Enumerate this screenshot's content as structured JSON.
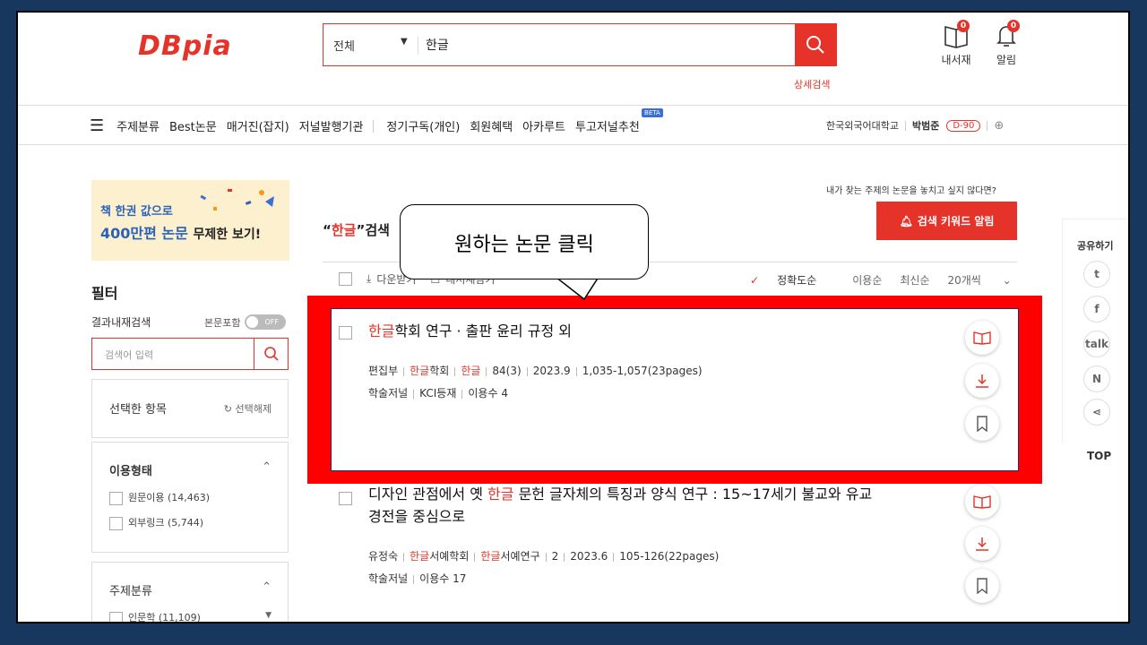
{
  "header": {
    "logo": "DBpia",
    "search_scope": "전체",
    "search_query": "한글",
    "advanced_search": "상세검색",
    "library_label": "내서재",
    "library_count": "0",
    "alarm_label": "알림",
    "alarm_count": "0"
  },
  "nav": {
    "items": [
      "주제분류",
      "Best논문",
      "매거진(잡지)",
      "저널발행기관",
      "정기구독(개인)",
      "회원혜택",
      "아카루트",
      "투고저널추천"
    ],
    "beta": "BETA",
    "university": "한국외국어대학교",
    "user_name": "박범준",
    "dday": "D-90"
  },
  "sidebar": {
    "banner_line1": "책 한권 값으로",
    "banner_line2a": "400만편 논문",
    "banner_line2b": "무제한 보기!",
    "filter_title": "필터",
    "result_search_label": "결과내재검색",
    "include_body_label": "본문포함",
    "toggle_state": "OFF",
    "filter_placeholder": "검색어 입력",
    "selected_label": "선택한 항목",
    "clear_label": "선택해제",
    "usage_title": "이용형태",
    "usage_items": [
      "원문이용 (14,463)",
      "외부링크 (5,744)"
    ],
    "subject_title": "주제분류",
    "subject_items": [
      "인문학 (11,109)"
    ]
  },
  "main": {
    "keyword_hint": "내가 찾는 주제의 논문을 놓치고 싶지 않다면?",
    "keyword_alarm_btn": "검색 키워드 알림",
    "result_prefix": "“",
    "result_keyword": "한글",
    "result_suffix": "”검색",
    "tool_download": "다운받기",
    "tool_library": "내서재담기",
    "sort_options": [
      "정확도순",
      "이용순",
      "최신순"
    ],
    "page_size": "20개씩",
    "results": [
      {
        "title_hl": "한글",
        "title_rest": "학회 연구 · 출판 윤리 규정 외",
        "author": "편집부",
        "publisher_hl": "한글",
        "publisher_rest": "학회",
        "journal_hl": "한글",
        "journal_rest": "",
        "volume": "84(3)",
        "date": "2023.9",
        "pages": "1,035-1,057(23pages)",
        "type": "학술저널",
        "index": "KCI등재",
        "usage": "이용수 4"
      },
      {
        "title_pre": "디자인 관점에서 옛 ",
        "title_hl": "한글",
        "title_rest": " 문헌 글자체의 특징과 양식 연구 : 15~17세기 불교와 유교",
        "title_line2": "경전을 중심으로",
        "author": "유정숙",
        "publisher_hl": "한글",
        "publisher_rest": "서예학회",
        "journal_hl": "한글",
        "journal_rest": "서예연구",
        "volume": "2",
        "date": "2023.6",
        "pages": "105-126(22pages)",
        "type": "학술저널",
        "usage": "이용수 17"
      }
    ]
  },
  "share": {
    "title": "공유하기",
    "top": "TOP"
  },
  "callout": {
    "text": "원하는 논문 클릭"
  },
  "colors": {
    "brand": "#e5332a",
    "highlight_frame": "#ff0000",
    "outer_background": "#17375e"
  }
}
